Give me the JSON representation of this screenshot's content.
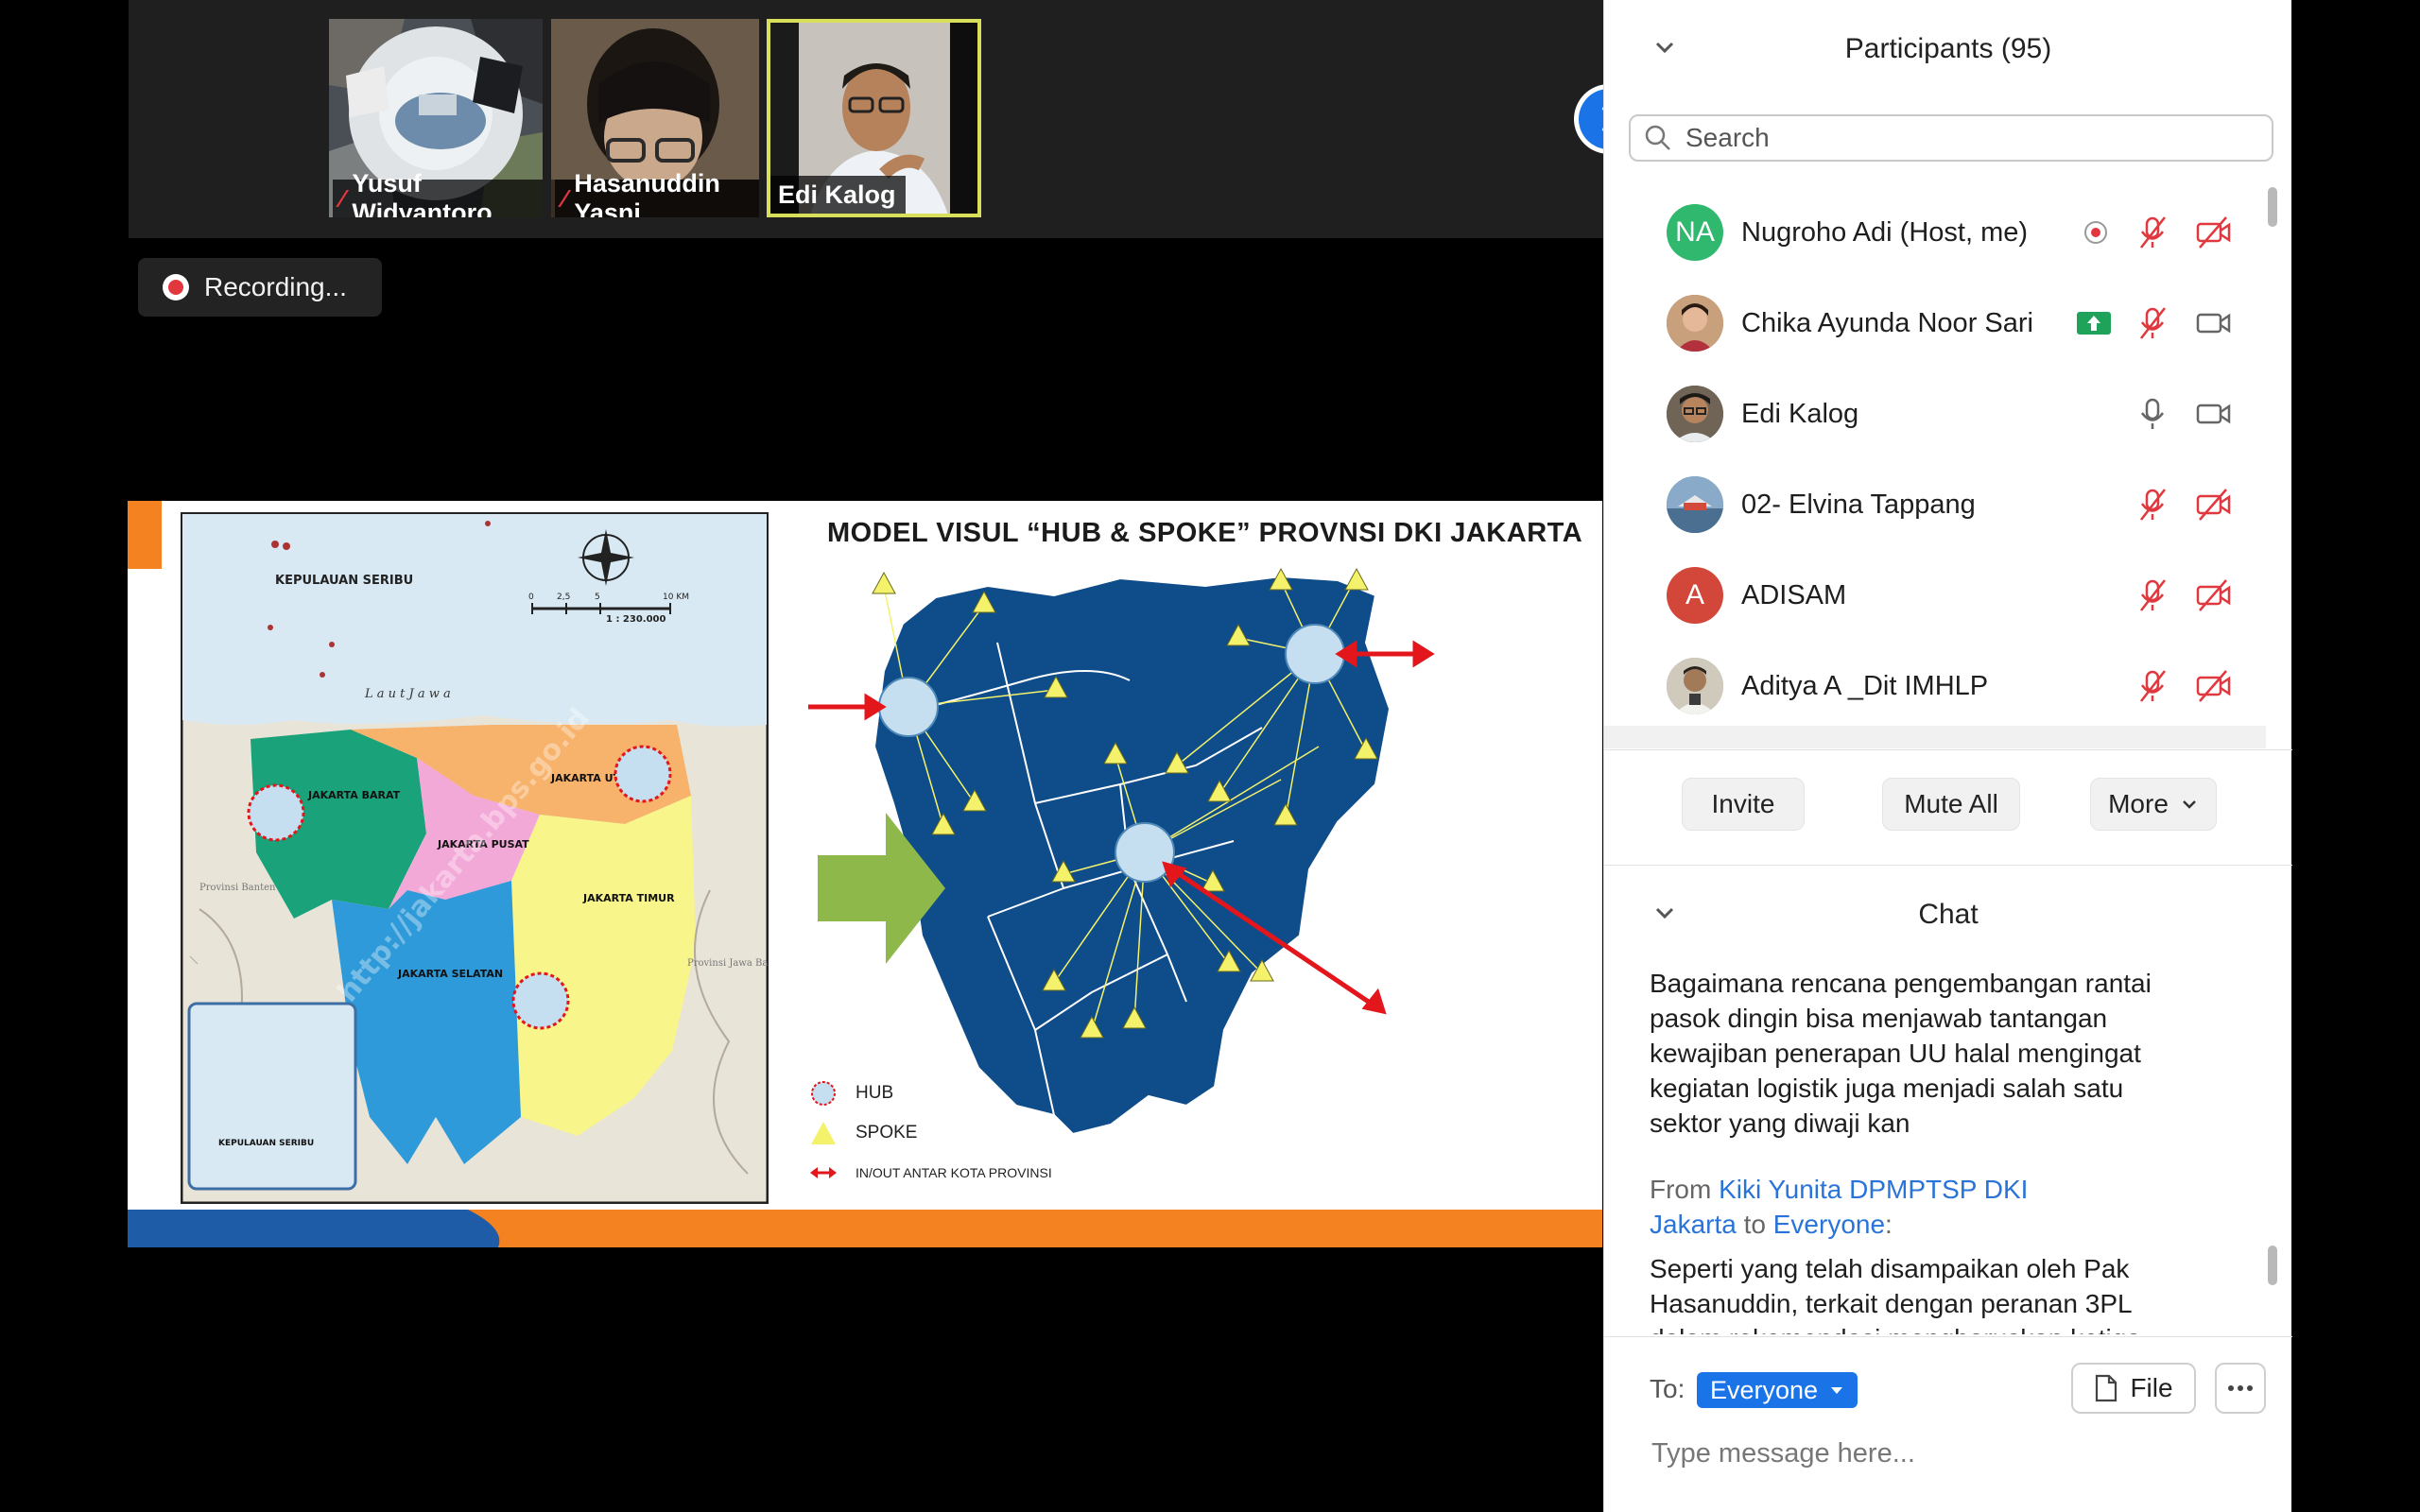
{
  "video_strip": {
    "tiles": [
      {
        "name": "Yusuf Widyantoro",
        "muted": true
      },
      {
        "name": "Hasanuddin Yasni",
        "muted": true
      },
      {
        "name": "Edi Kalog",
        "muted": false,
        "active_speaker": true
      }
    ],
    "next_page_icon": "chevron-right-icon"
  },
  "recording": {
    "label": "Recording..."
  },
  "slide": {
    "title": "MODEL VISUL “HUB & SPOKE” PROVNSI DKI JAKARTA",
    "map_labels": {
      "islands": "KEPULAUAN SERIBU",
      "islands_inset": "KEPULAUAN SERIBU",
      "sea": "L a u t   J a w a",
      "scale": "1 : 230.000",
      "scale_ticks": [
        "0",
        "2,5",
        "5",
        "10 KM"
      ],
      "west": "JAKARTA BARAT",
      "north": "JAKARTA UTARA",
      "central": "JAKARTA PUSAT",
      "east": "JAKARTA TIMUR",
      "south": "JAKARTA SELATAN",
      "banten": "Provinsi Banten",
      "jabar": "Provinsi Jawa Barat",
      "watermark": "http://jakarta.bps.go.id"
    },
    "legend": [
      {
        "label": "HUB",
        "icon": "hub-circle-icon"
      },
      {
        "label": "SPOKE",
        "icon": "spoke-triangle-icon"
      },
      {
        "label": "IN/OUT ANTAR KOTA PROVINSI",
        "icon": "double-arrow-icon"
      }
    ],
    "colors": {
      "accent": "#f58220",
      "map_blue": "#0f4c8a",
      "hub": "#c6dff0",
      "spoke": "#f4f26a",
      "arrow": "#e3161c",
      "green_arrow": "#8fb84a"
    }
  },
  "participants": {
    "title": "Participants (95)",
    "search_placeholder": "Search",
    "rows": [
      {
        "name": "Nugroho Adi (Host, me)",
        "initials": "NA",
        "avatar_color": "#2fb86e",
        "mic": "muted",
        "video": "off",
        "recording": true
      },
      {
        "name": "Chika Ayunda Noor Sari",
        "initials": "",
        "avatar_color": "#8a5a44",
        "mic": "muted",
        "video": "on",
        "share": true
      },
      {
        "name": "Edi Kalog",
        "initials": "",
        "avatar_color": "#5d4a3a",
        "mic": "on",
        "video": "on"
      },
      {
        "name": "02- Elvina Tappang",
        "initials": "",
        "avatar_color": "#6a8fb4",
        "mic": "muted",
        "video": "off"
      },
      {
        "name": "ADISAM",
        "initials": "A",
        "avatar_color": "#d2473a",
        "mic": "muted",
        "video": "off"
      },
      {
        "name": "Aditya A _Dit IMHLP",
        "initials": "",
        "avatar_color": "#9a9a8a",
        "mic": "muted",
        "video": "off"
      }
    ],
    "buttons": {
      "invite": "Invite",
      "mute_all": "Mute All",
      "more": "More"
    }
  },
  "chat": {
    "title": "Chat",
    "messages": [
      {
        "text": "Bagaimana rencana pengembangan rantai\npasok dingin bisa menjawab tantangan\nkewajiban penerapan UU halal mengingat\nkegiatan logistik juga menjadi  salah satu\nsektor yang diwaji kan"
      },
      {
        "from_prefix": "From ",
        "from": "Kiki Yunita DPMPTSP DKI\nJakarta",
        "to_word": " to ",
        "to": "Everyone",
        "suffix": ":",
        "text": "Seperti yang telah disampaikan oleh Pak\nHasanuddin, terkait dengan peranan 3PL\ndalam rekomendasi mengharuskan ketiga"
      }
    ],
    "to_label": "To:",
    "recipient": "Everyone",
    "file_button": "File",
    "input_placeholder": "Type message here..."
  }
}
